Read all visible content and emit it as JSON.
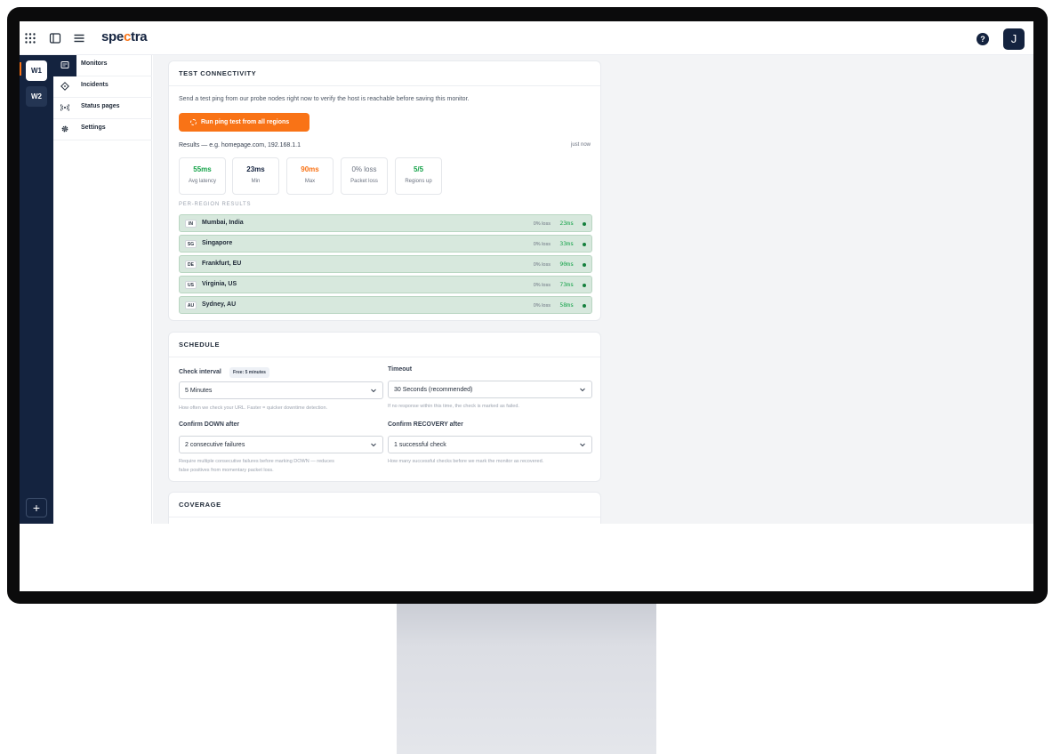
{
  "app": {
    "logo_pre": "spe",
    "logo_accent": "c",
    "logo_post": "tra",
    "help": "?",
    "avatar": "J"
  },
  "workspaces": [
    {
      "label": "W1"
    },
    {
      "label": "W2"
    }
  ],
  "rail": {
    "add": "+"
  },
  "nav": {
    "items": [
      {
        "label": "Monitors",
        "icon": "monitor-icon"
      },
      {
        "label": "Incidents",
        "icon": "diamond-alert-icon"
      },
      {
        "label": "Status pages",
        "icon": "broadcast-icon"
      },
      {
        "label": "Settings",
        "icon": "gear-icon"
      }
    ]
  },
  "connectivity": {
    "title": "TEST CONNECTIVITY",
    "description": "Send a test ping from our probe nodes right now to verify the host is reachable before saving this monitor.",
    "run_button": "Run ping test from all regions",
    "results_label": "Results — e.g. homepage.com, 192.168.1.1",
    "results_time": "just now",
    "stats": [
      {
        "value": "55ms",
        "label": "Avg latency",
        "color": "#16a34a"
      },
      {
        "value": "23ms",
        "label": "Min",
        "color": "#14233f"
      },
      {
        "value": "90ms",
        "label": "Max",
        "color": "#f97316"
      },
      {
        "value": "0% loss",
        "label": "Packet loss",
        "color": "#6b7280"
      },
      {
        "value": "5/5",
        "label": "Regions up",
        "color": "#16a34a"
      }
    ],
    "per_region_label": "PER-REGION RESULTS",
    "regions": [
      {
        "code": "IN",
        "name": "Mumbai, India",
        "loss": "0% loss",
        "latency": "23ms"
      },
      {
        "code": "SG",
        "name": "Singapore",
        "loss": "0% loss",
        "latency": "33ms"
      },
      {
        "code": "DE",
        "name": "Frankfurt, EU",
        "loss": "0% loss",
        "latency": "90ms"
      },
      {
        "code": "US",
        "name": "Virginia, US",
        "loss": "0% loss",
        "latency": "73ms"
      },
      {
        "code": "AU",
        "name": "Sydney, AU",
        "loss": "0% loss",
        "latency": "58ms"
      }
    ]
  },
  "schedule": {
    "title": "SCHEDULE",
    "check_interval_label": "Check interval",
    "free_badge": "Free: 5 minutes",
    "check_interval_value": "5 Minutes",
    "check_interval_hint": "How often we check your URL. Faster = quicker downtime detection.",
    "timeout_label": "Timeout",
    "timeout_value": "30 Seconds (recommended)",
    "timeout_hint": "If no response within this time, the check is marked as failed.",
    "confirm_down_label": "Confirm DOWN after",
    "confirm_down_value": "2 consecutive failures",
    "confirm_down_hint_1": "Require multiple consecutive failures before marking DOWN — reduces",
    "confirm_down_hint_2": "false positives from momentary packet loss.",
    "confirm_recovery_label": "Confirm RECOVERY after",
    "confirm_recovery_value": "1 successful check",
    "confirm_recovery_hint": "How many successful checks before we mark the monitor as recovered."
  },
  "coverage": {
    "title": "COVERAGE"
  }
}
